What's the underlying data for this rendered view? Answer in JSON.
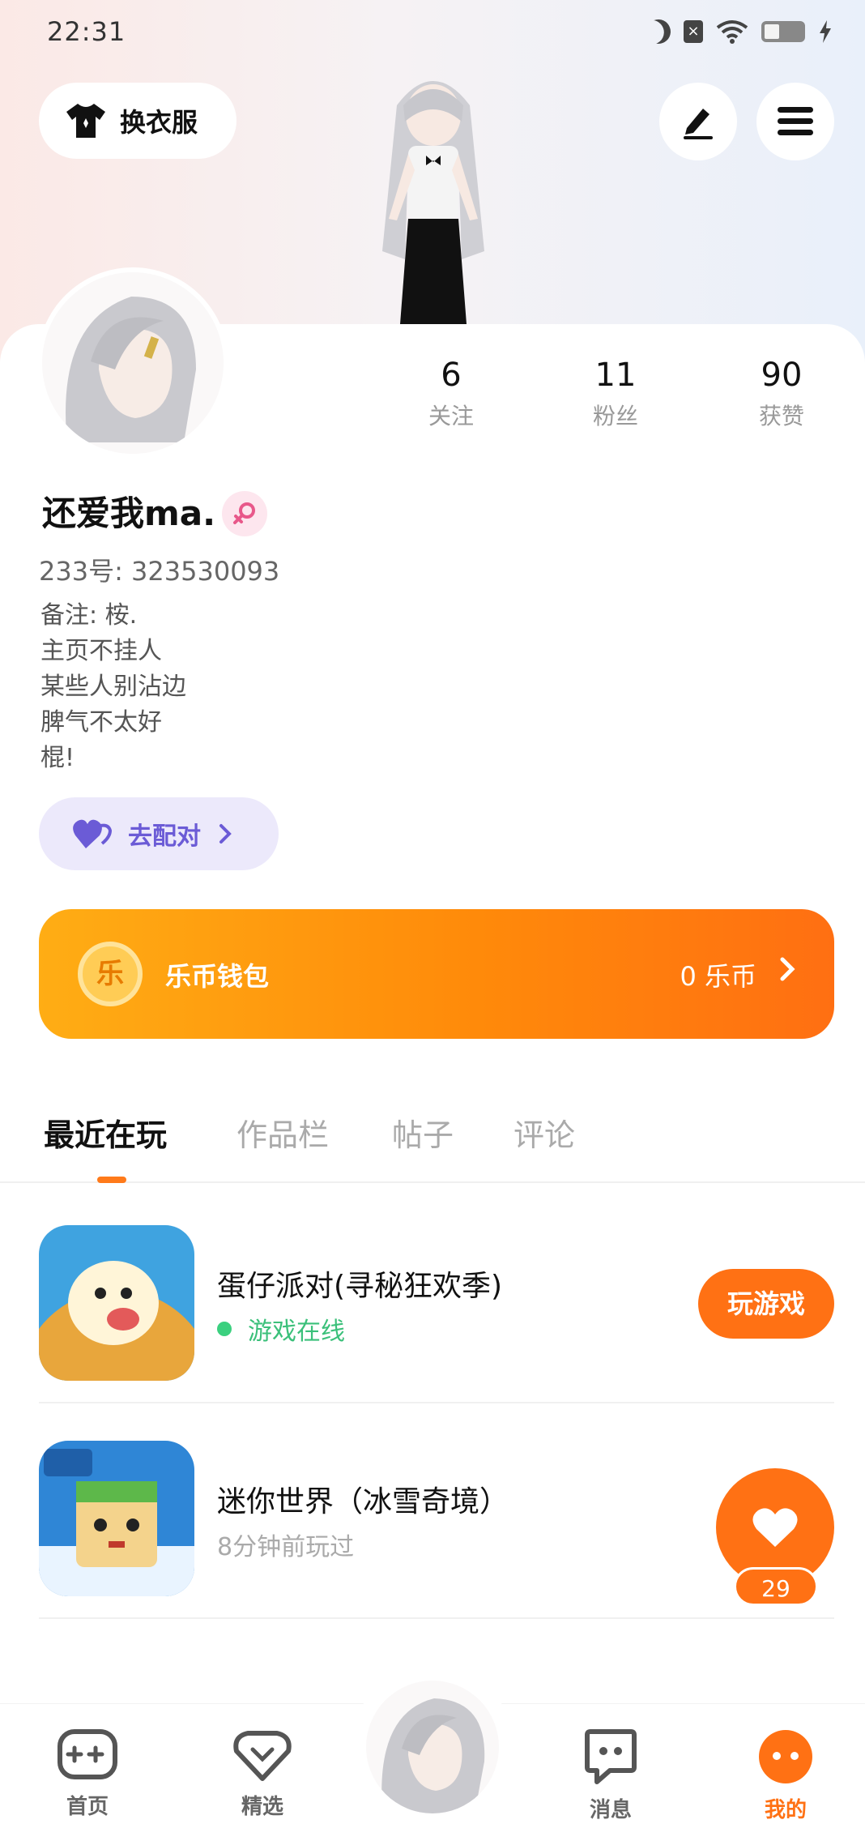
{
  "status_bar": {
    "time": "22:31"
  },
  "header": {
    "outfit_label": "换衣服",
    "edit_icon": "pen-icon",
    "menu_icon": "hamburger-icon"
  },
  "profile": {
    "stats": [
      {
        "value": "6",
        "label": "关注"
      },
      {
        "value": "11",
        "label": "粉丝"
      },
      {
        "value": "90",
        "label": "获赞"
      }
    ],
    "username": "还爱我ma.",
    "gender": "female",
    "uid": "233号: 323530093",
    "bio": "备注: 桉.\n主页不挂人\n某些人别沾边\n脾气不太好\n棍!",
    "match_label": "去配对"
  },
  "wallet": {
    "coin_glyph": "乐",
    "title": "乐币钱包",
    "balance": "0 乐币"
  },
  "tabs": [
    "最近在玩",
    "作品栏",
    "帖子",
    "评论"
  ],
  "games": [
    {
      "name": "蛋仔派对(寻秘狂欢季)",
      "status": "游戏在线",
      "button": "玩游戏"
    },
    {
      "name": "迷你世界（冰雪奇境）",
      "status": "8分钟前玩过"
    }
  ],
  "like_float": {
    "count": "29"
  },
  "bottom_nav": [
    {
      "label": "首页",
      "icon": "gamepad-icon"
    },
    {
      "label": "精选",
      "icon": "heart-shield-icon"
    },
    {
      "label": "消息",
      "icon": "chat-icon"
    },
    {
      "label": "我的",
      "icon": "me-icon",
      "active": true
    }
  ],
  "colors": {
    "accent": "#ff7114",
    "match_bg": "#ece9fb",
    "online_green": "#3bc07a"
  }
}
